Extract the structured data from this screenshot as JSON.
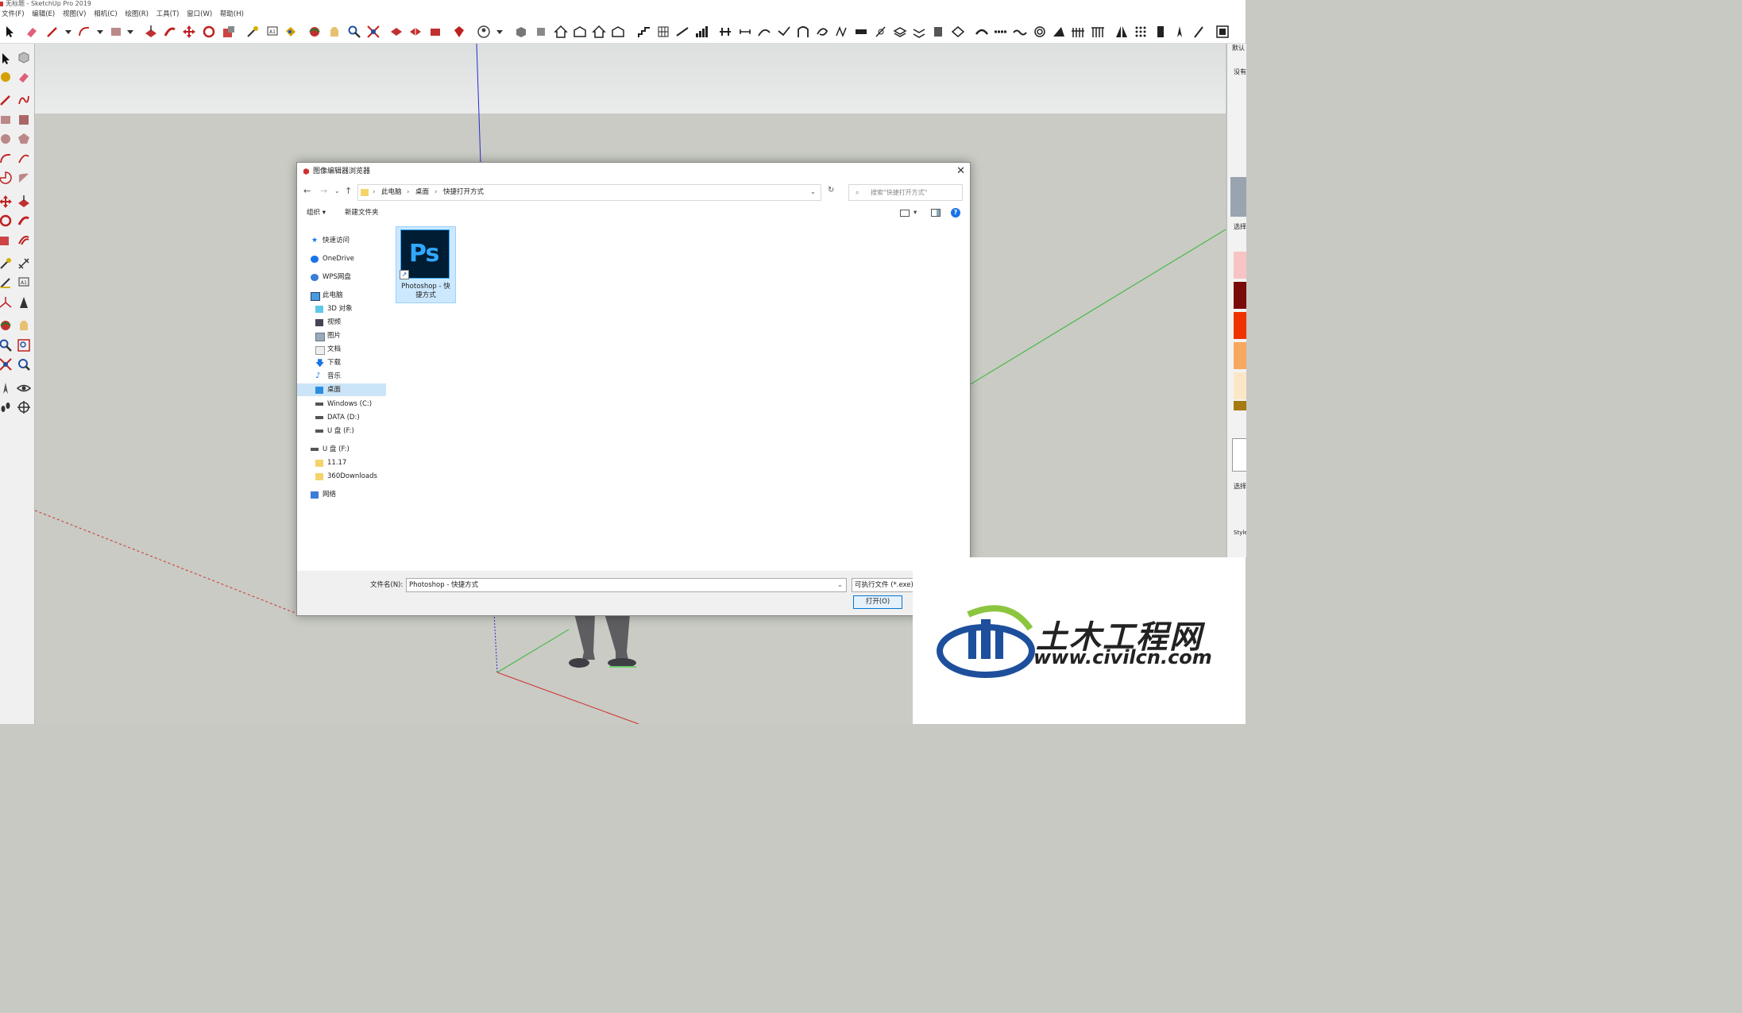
{
  "window": {
    "title": "无标题 - SketchUp Pro 2019"
  },
  "menu": [
    "文件(F)",
    "编辑(E)",
    "视图(V)",
    "相机(C)",
    "绘图(R)",
    "工具(T)",
    "窗口(W)",
    "帮助(H)"
  ],
  "right_panel": {
    "tray_title": "默认",
    "line2": "没有",
    "select_label_1": "选择",
    "select_label_2": "选择",
    "styles_label": "Style"
  },
  "dialog": {
    "title": "图像编辑器浏览器",
    "breadcrumb": [
      "此电脑",
      "桌面",
      "快捷打开方式"
    ],
    "search_placeholder": "搜索\"快捷打开方式\"",
    "organize": "组织",
    "new_folder": "新建文件夹",
    "nav": {
      "quick_access": "快速访问",
      "onedrive": "OneDrive",
      "wps": "WPS网盘",
      "this_pc": "此电脑",
      "pc_items": [
        "3D 对象",
        "视频",
        "图片",
        "文档",
        "下载",
        "音乐",
        "桌面",
        "Windows (C:)",
        "DATA (D:)",
        "U 盘 (F:)"
      ],
      "usb": "U 盘 (F:)",
      "usb_items": [
        "11.17",
        "360Downloads"
      ],
      "network": "网络"
    },
    "file": {
      "icon_text": "Ps",
      "name_line1": "Photoshop - 快",
      "name_line2": "捷方式"
    },
    "filename_label": "文件名(N):",
    "filename_value": "Photoshop - 快捷方式",
    "filetype": "可执行文件 (*.exe)",
    "open_button": "打开(O)"
  },
  "watermark": {
    "brand": "土木工程网",
    "url": "www.civilcn.com"
  },
  "colors": {
    "ps_bg": "#001d34",
    "ps_blue": "#31a8ff",
    "selection": "#cce4f7",
    "axis_blue": "#2a2ad0",
    "axis_green": "#2fb52f",
    "axis_red": "#d03030"
  }
}
